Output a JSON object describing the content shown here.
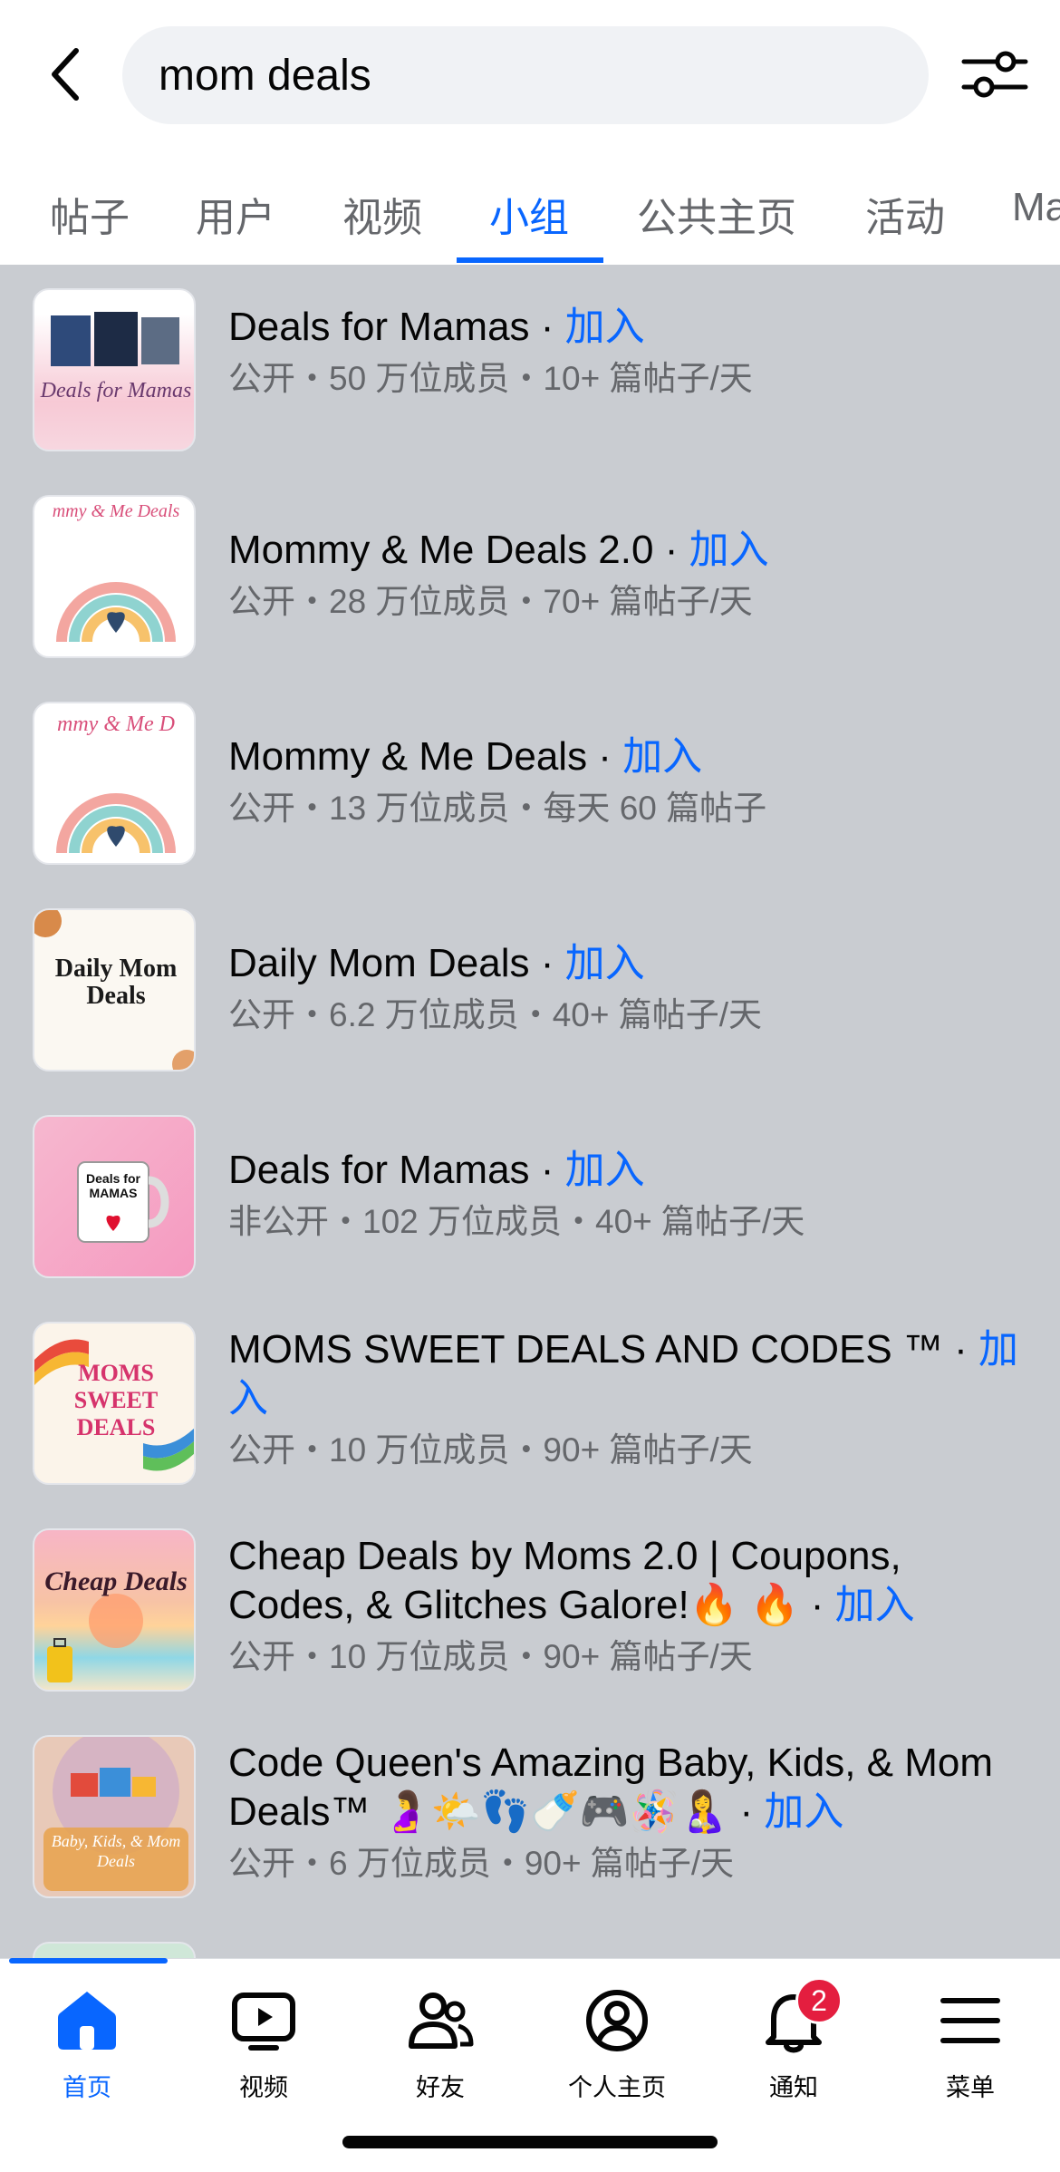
{
  "search": {
    "query": "mom deals"
  },
  "tabs": [
    {
      "label": "帖子"
    },
    {
      "label": "用户"
    },
    {
      "label": "视频"
    },
    {
      "label": "小组"
    },
    {
      "label": "公共主页"
    },
    {
      "label": "活动"
    },
    {
      "label": "Ma"
    }
  ],
  "active_tab": "小组",
  "join_label": "加入",
  "groups": [
    {
      "name": "Deals for Mamas",
      "meta": "公开・50 万位成员・10+ 篇帖子/天",
      "thumb_text": "Deals for Mamas"
    },
    {
      "name": "Mommy & Me Deals 2.0",
      "meta": "公开・28 万位成员・70+ 篇帖子/天",
      "thumb_text": "mmy & Me Deals"
    },
    {
      "name": "Mommy & Me Deals",
      "meta": "公开・13 万位成员・每天 60 篇帖子",
      "thumb_text": "mmy & Me D"
    },
    {
      "name": "Daily Mom Deals",
      "meta": "公开・6.2 万位成员・40+ 篇帖子/天",
      "thumb_text": "Daily Mom Deals"
    },
    {
      "name": "Deals for Mamas",
      "meta": "非公开・102 万位成员・40+ 篇帖子/天",
      "thumb_text": "Deals for MAMAS"
    },
    {
      "name": "MOMS SWEET DEALS AND CODES ™",
      "meta": "公开・10 万位成员・90+ 篇帖子/天",
      "thumb_text": "MOMS SWEET DEALS"
    },
    {
      "name": "Cheap Deals by Moms 2.0 | Coupons, Codes, & Glitches Galore!🔥 🔥",
      "meta": "公开・10 万位成员・90+ 篇帖子/天",
      "thumb_text": "Cheap Deals"
    },
    {
      "name": "Code Queen's Amazing Baby, Kids, & Mom Deals™ 🤰🌤️👣🍼🎮🪅🤱",
      "meta": "公开・6 万位成员・90+ 篇帖子/天",
      "thumb_text": "Baby, Kids, & Mom Deals"
    }
  ],
  "nav": [
    {
      "label": "首页",
      "icon": "home-icon"
    },
    {
      "label": "视频",
      "icon": "video-icon"
    },
    {
      "label": "好友",
      "icon": "friends-icon"
    },
    {
      "label": "个人主页",
      "icon": "profile-icon"
    },
    {
      "label": "通知",
      "icon": "bell-icon",
      "badge": "2"
    },
    {
      "label": "菜单",
      "icon": "menu-icon"
    }
  ],
  "colors": {
    "accent": "#0866ff",
    "results_bg": "#c9ccd1",
    "badge": "#e41e3f"
  }
}
